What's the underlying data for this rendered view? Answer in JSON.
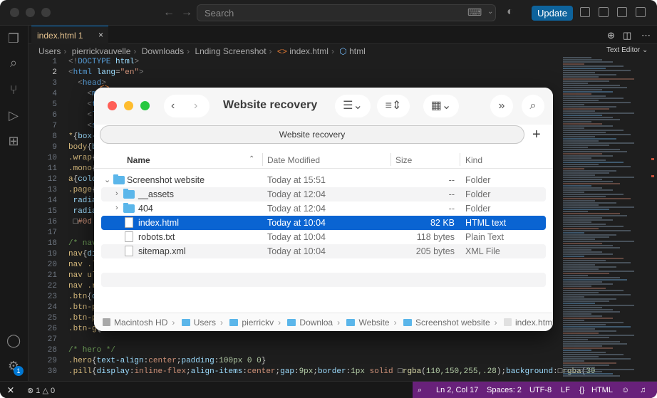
{
  "titlebar": {
    "search_placeholder": "Search",
    "update_label": "Update"
  },
  "tab": {
    "filename": "index.html",
    "problems": "1",
    "icon_text": "<>"
  },
  "breadcrumbs": [
    "Users",
    "pierrickvauvelle",
    "Downloads",
    "Lnding Screenshot",
    "index.html",
    "html"
  ],
  "text_editor_label": "Text Editor",
  "editor": {
    "line_numbers": [
      "1",
      "2",
      "3",
      "4",
      "5",
      "6",
      "7",
      "8",
      "9",
      "10",
      "11",
      "12",
      "13",
      "14",
      "15",
      "16",
      "17",
      "18",
      "19",
      "20",
      "21",
      "22",
      "23",
      "24",
      "25",
      "26",
      "27",
      "28",
      "29",
      "30"
    ],
    "current_line": "2"
  },
  "finder": {
    "title": "Website recovery",
    "path_label": "Website recovery",
    "columns": {
      "name": "Name",
      "date": "Date Modified",
      "size": "Size",
      "kind": "Kind"
    },
    "rows": [
      {
        "name": "Screenshot website",
        "date": "Today at 15:51",
        "size": "--",
        "kind": "Folder"
      },
      {
        "name": "__assets",
        "date": "Today at 12:04",
        "size": "--",
        "kind": "Folder"
      },
      {
        "name": "404",
        "date": "Today at 12:04",
        "size": "--",
        "kind": "Folder"
      },
      {
        "name": "index.html",
        "date": "Today at 10:04",
        "size": "82 KB",
        "kind": "HTML text"
      },
      {
        "name": "robots.txt",
        "date": "Today at 10:04",
        "size": "118 bytes",
        "kind": "Plain Text"
      },
      {
        "name": "sitemap.xml",
        "date": "Today at 10:04",
        "size": "205 bytes",
        "kind": "XML File"
      }
    ],
    "pathbar": [
      "Macintosh HD",
      "Users",
      "pierrickv",
      "Downloa",
      "Website",
      "Screenshot website",
      "index.html"
    ]
  },
  "status": {
    "errors": "1",
    "warnings": "0",
    "position": "Ln 2, Col 17",
    "spaces": "Spaces: 2",
    "encoding": "UTF-8",
    "eol": "LF",
    "language": "HTML",
    "language_icon": "{}"
  },
  "colors": {
    "accent": "#0078d4",
    "status_bar_accent": "#68217a",
    "finder_selection": "#0a64d2"
  },
  "icons": [
    "explorer-icon",
    "search-icon",
    "source-control-icon",
    "run-debug-icon",
    "extensions-icon",
    "account-icon",
    "manage-gear-icon"
  ]
}
